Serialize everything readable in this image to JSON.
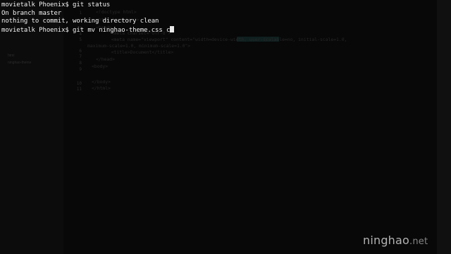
{
  "terminal": {
    "lines": [
      "movietalk Phoenix$ git status",
      "On branch master",
      "nothing to commit, working directory clean",
      "movietalk Phoenix$ git mv ninghao-theme.css c"
    ]
  },
  "editor_background": {
    "sidebar_items": [
      "html",
      "ninghao-theme"
    ],
    "line_numbers": [
      "1",
      "2",
      "3",
      "4",
      "5",
      "6",
      "7",
      "8",
      "9",
      "10",
      "11"
    ],
    "code_lines": [
      "<!doctype html>",
      "<html lang=\"en\">",
      "<head>",
      "  <meta charset=\"UTF-8\">",
      "  <meta name=\"viewport\" content=\"width=device-width, user-scalable=no, initial-scale=1.0,",
      "maximum-scale=1.0, minimum-scale=1.0\">",
      "  <title>Document</title>",
      "</head>",
      "<body>",
      "",
      "</body>",
      "</html>"
    ]
  },
  "watermark": {
    "name": "ninghao",
    "tld": ".net"
  },
  "colors": {
    "terminal_text": "#f2f2f2",
    "background": "#030303"
  }
}
